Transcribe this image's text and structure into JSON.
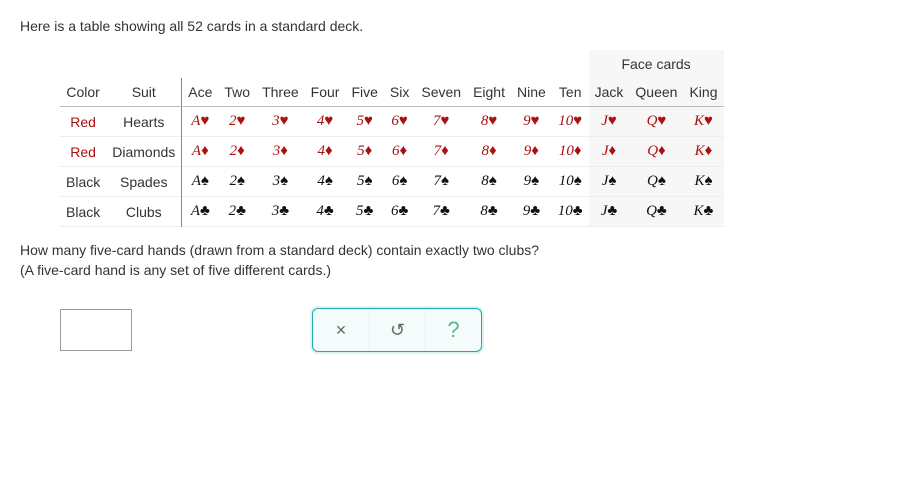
{
  "intro": "Here is a table showing all 52 cards in a standard deck.",
  "headers": {
    "color": "Color",
    "suit": "Suit",
    "face_group": "Face cards",
    "ranks": [
      "Ace",
      "Two",
      "Three",
      "Four",
      "Five",
      "Six",
      "Seven",
      "Eight",
      "Nine",
      "Ten",
      "Jack",
      "Queen",
      "King"
    ]
  },
  "rank_symbols": [
    "A",
    "2",
    "3",
    "4",
    "5",
    "6",
    "7",
    "8",
    "9",
    "10",
    "J",
    "Q",
    "K"
  ],
  "suits": [
    {
      "color": "Red",
      "name": "Hearts",
      "symbol": "♥",
      "css": "red-card",
      "rowcss": "red-row"
    },
    {
      "color": "Red",
      "name": "Diamonds",
      "symbol": "♦",
      "css": "red-card",
      "rowcss": "red-row"
    },
    {
      "color": "Black",
      "name": "Spades",
      "symbol": "♠",
      "css": "black-card",
      "rowcss": ""
    },
    {
      "color": "Black",
      "name": "Clubs",
      "symbol": "♣",
      "css": "black-card",
      "rowcss": ""
    }
  ],
  "question": {
    "line1": "How many five-card hands (drawn from a standard deck) contain exactly two clubs?",
    "line2": "(A five-card hand is any set of five different cards.)"
  },
  "answer_value": "",
  "buttons": {
    "clear": "×",
    "reset": "↺",
    "help": "?"
  }
}
